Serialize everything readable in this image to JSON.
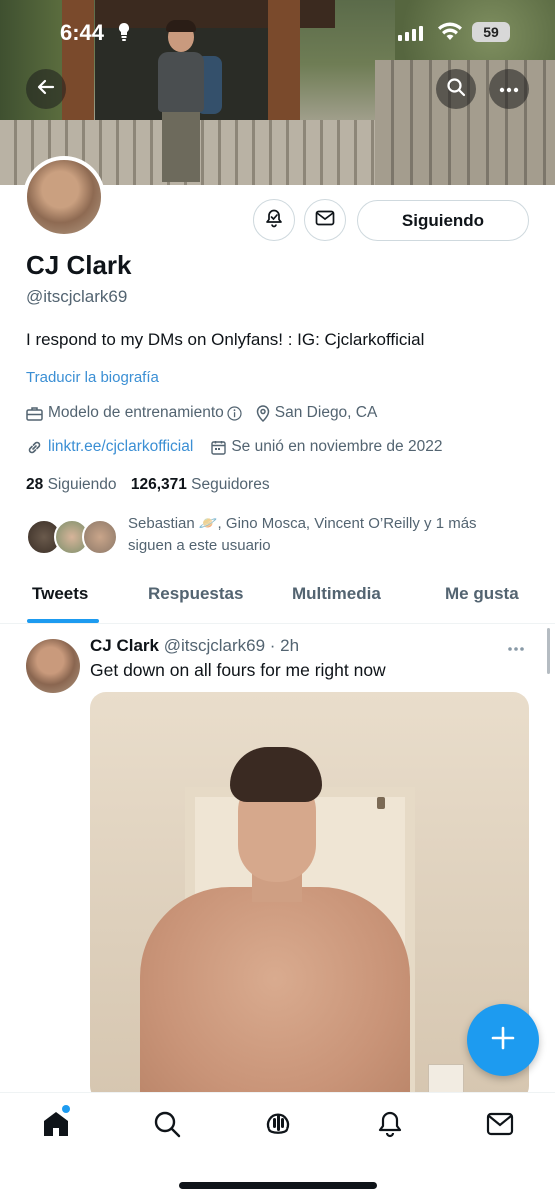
{
  "status_bar": {
    "time": "6:44",
    "battery": "59"
  },
  "profile": {
    "name": "CJ Clark",
    "handle": "@itscjclark69",
    "bio": "I respond to my DMs on Onlyfans! : IG: Cjclarkofficial",
    "translate_link": "Traducir la biografía",
    "category": "Modelo de entrenamiento",
    "location": "San Diego, CA",
    "website": "linktr.ee/cjclarkofficial",
    "joined": "Se unió en noviembre de 2022",
    "following_count": "28",
    "following_label": "Siguiendo",
    "followers_count": "126,371",
    "followers_label": "Seguidores",
    "follow_button": "Siguiendo",
    "followed_by_line1": "Sebastian 🪐, Gino Mosca, Vincent O’Reilly y 1 más",
    "followed_by_line2": "siguen a este usuario"
  },
  "tabs": [
    "Tweets",
    "Respuestas",
    "Multimedia",
    "Me gusta"
  ],
  "tweet": {
    "name": "CJ Clark",
    "handle_time": "@itscjclark69 · 2h",
    "text": "Get down on all fours for me right now"
  },
  "colors": {
    "accent": "#1d9bf0",
    "link": "#3b8fd4",
    "muted": "#536471",
    "text": "#0f1419"
  },
  "icons": [
    "back-arrow-icon",
    "search-icon",
    "more-icon",
    "notification-bell-icon",
    "mail-icon",
    "briefcase-icon",
    "info-icon",
    "location-pin-icon",
    "link-icon",
    "calendar-icon",
    "plus-icon",
    "home-icon",
    "spaces-icon"
  ]
}
